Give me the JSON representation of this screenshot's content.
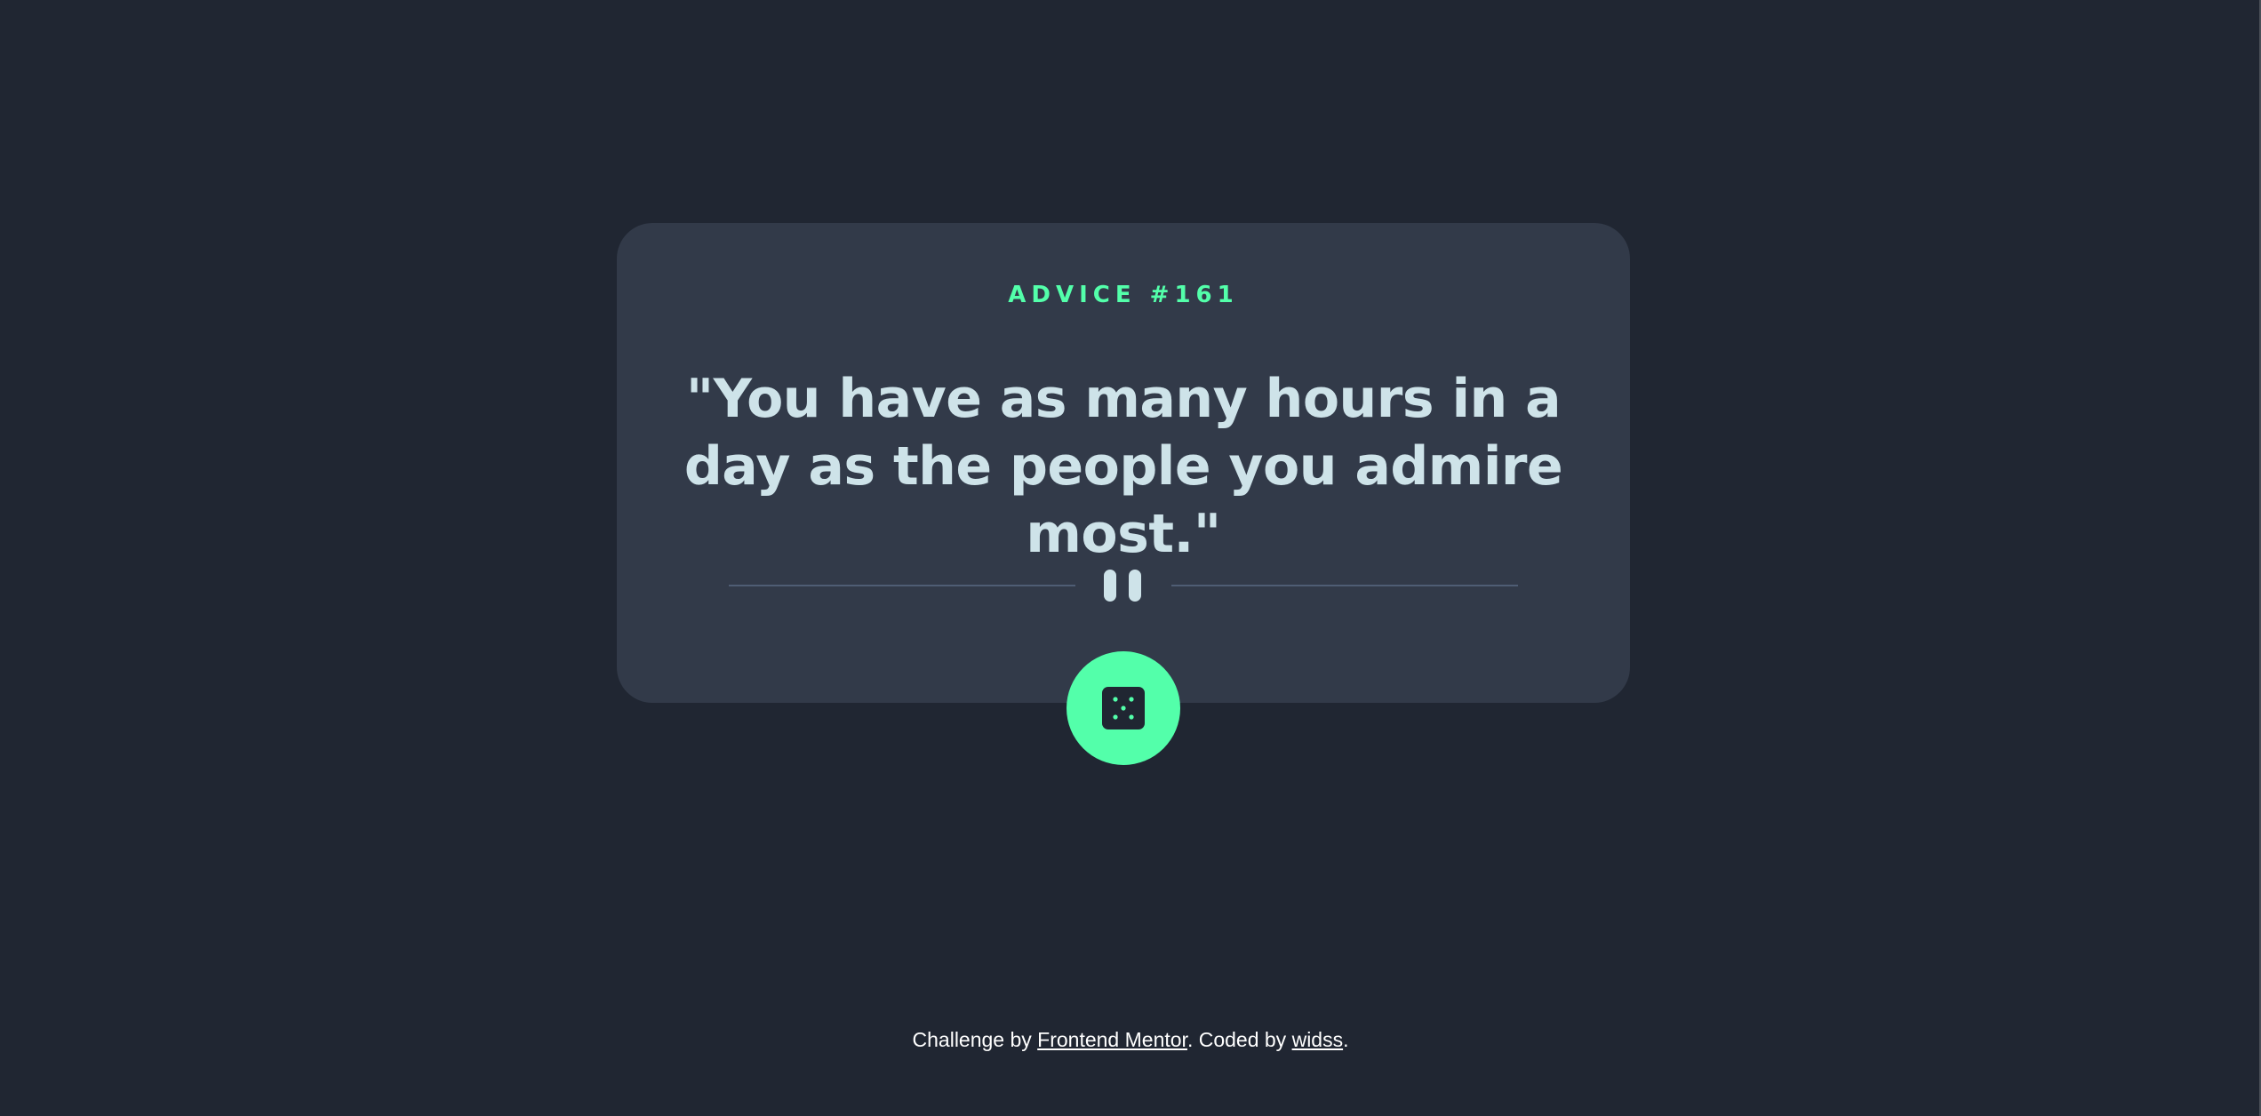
{
  "advice": {
    "label": "ADVICE",
    "hash": "#",
    "number": "161",
    "quote": "\"You have as many hours in a day as the people you admire most.\""
  },
  "divider": {
    "icon": "pause-icon"
  },
  "dice_button": {
    "icon": "dice-icon"
  },
  "footer": {
    "prefix": "Challenge by ",
    "link1": "Frontend Mentor",
    "middle": ". Coded by ",
    "link2": "widss",
    "suffix": "."
  },
  "colors": {
    "background": "#202632",
    "card": "#323a49",
    "accent": "#53ffaa",
    "text": "#cee3e9",
    "divider": "#4f5d74"
  }
}
